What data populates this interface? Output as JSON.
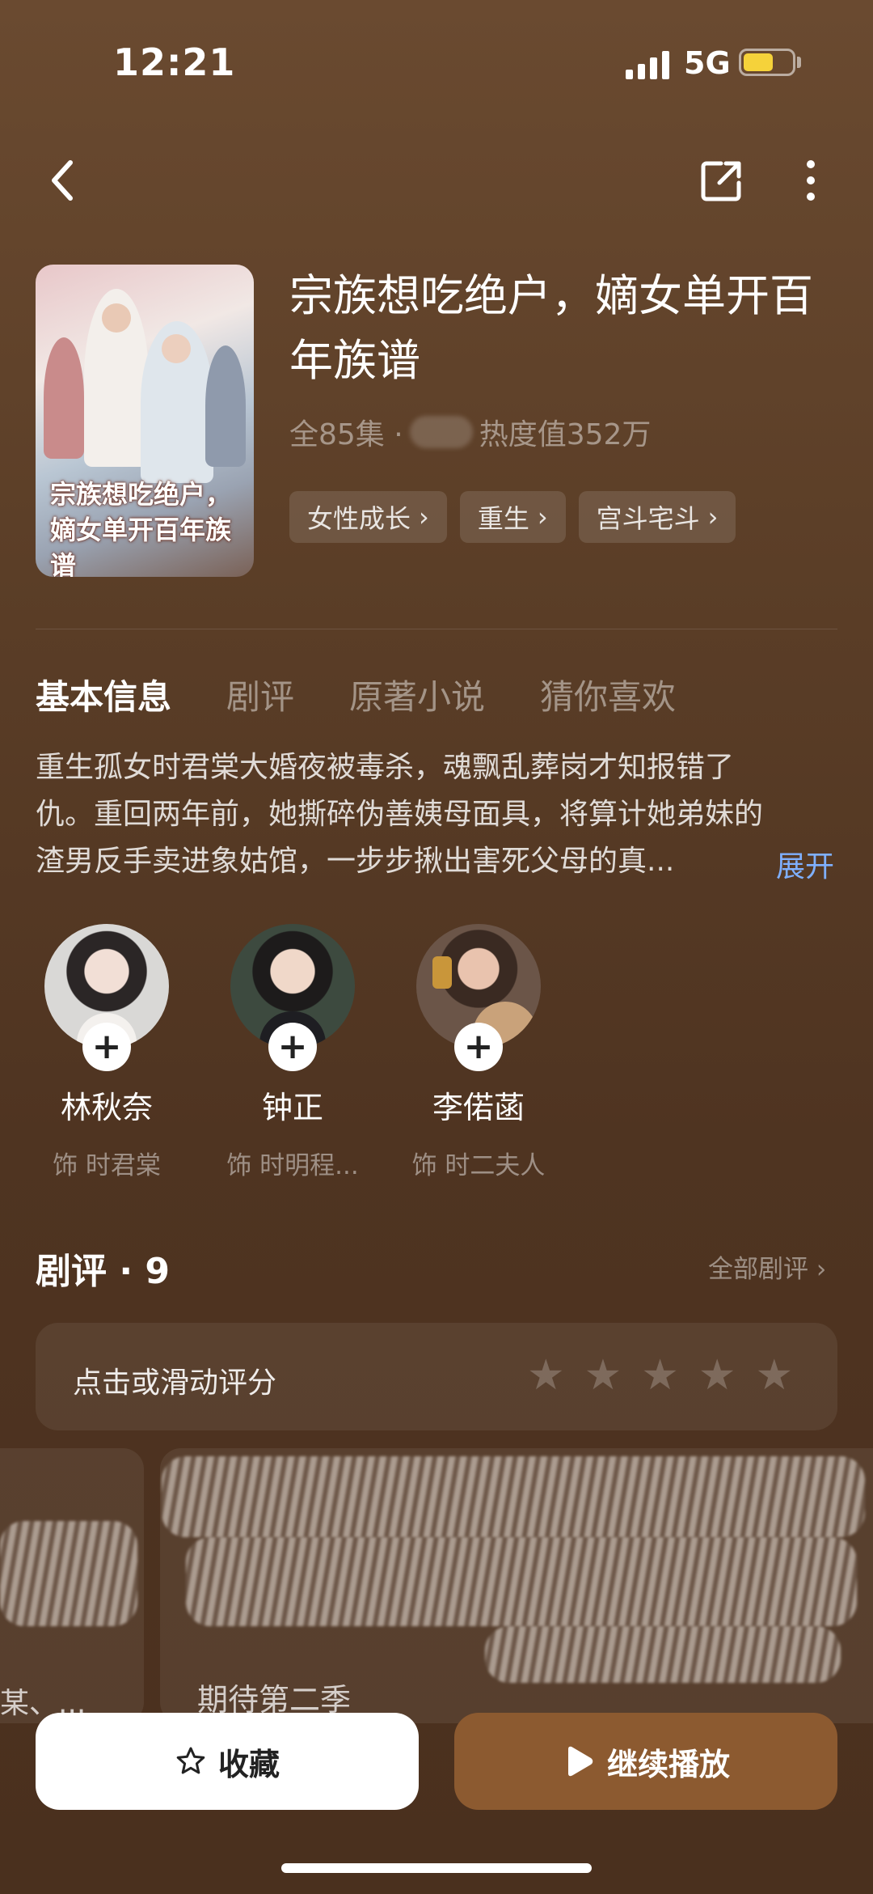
{
  "status_bar": {
    "time": "12:21",
    "network": "5G",
    "battery_level": 0.62,
    "battery_color": "#f5d23a"
  },
  "nav": {
    "back_icon": "chevron-left-icon",
    "share_icon": "share-icon",
    "more_icon": "more-vertical-icon"
  },
  "drama": {
    "poster_title_line1": "宗族想吃绝户，",
    "poster_title_line2": "嫡女单开百年族谱",
    "title": "宗族想吃绝户，嫡女单开百年族谱",
    "episodes": "全85集 ·",
    "heat": "热度值352万",
    "tags": [
      {
        "label": "女性成长"
      },
      {
        "label": "重生"
      },
      {
        "label": "宫斗宅斗"
      }
    ]
  },
  "tabs": [
    {
      "label": "基本信息",
      "active": true
    },
    {
      "label": "剧评"
    },
    {
      "label": "原著小说"
    },
    {
      "label": "猜你喜欢"
    }
  ],
  "description": "重生孤女时君棠大婚夜被毒杀，魂飘乱葬岗才知报错了仇。重回两年前，她撕碎伪善姨母面具，将算计她弟妹的渣男反手卖进象姑馆，一步步揪出害死父母的真...",
  "expand_label": "展开",
  "cast": [
    {
      "name": "林秋奈",
      "role": "饰 时君棠"
    },
    {
      "name": "钟正",
      "role": "饰 时明程..."
    },
    {
      "name": "李偌菡",
      "role": "饰 时二夫人"
    }
  ],
  "reviews": {
    "title": "剧评 · 9",
    "all_label": "全部剧评",
    "rate_prompt": "点击或滑动评分",
    "star_count": 5,
    "left_snippet": "某、...",
    "main_snippet": "期待第二季"
  },
  "buttons": {
    "favorite_label": "收藏",
    "play_label": "继续播放",
    "play_color": "#8c5a30"
  }
}
